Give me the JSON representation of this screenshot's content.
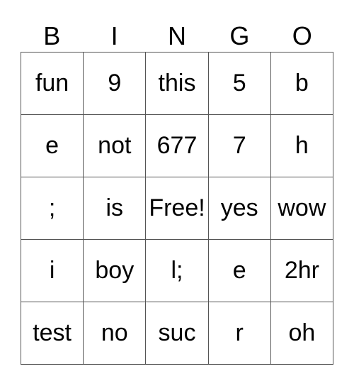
{
  "header": [
    "B",
    "I",
    "N",
    "G",
    "O"
  ],
  "rows": [
    [
      "fun",
      "9",
      "this",
      "5",
      "b"
    ],
    [
      "e",
      "not",
      "677",
      "7",
      "h"
    ],
    [
      ";",
      "is",
      "Free!",
      "yes",
      "wow"
    ],
    [
      "i",
      "boy",
      "l;",
      "e",
      "2hr"
    ],
    [
      "test",
      "no",
      "suc",
      "r",
      "oh"
    ]
  ]
}
